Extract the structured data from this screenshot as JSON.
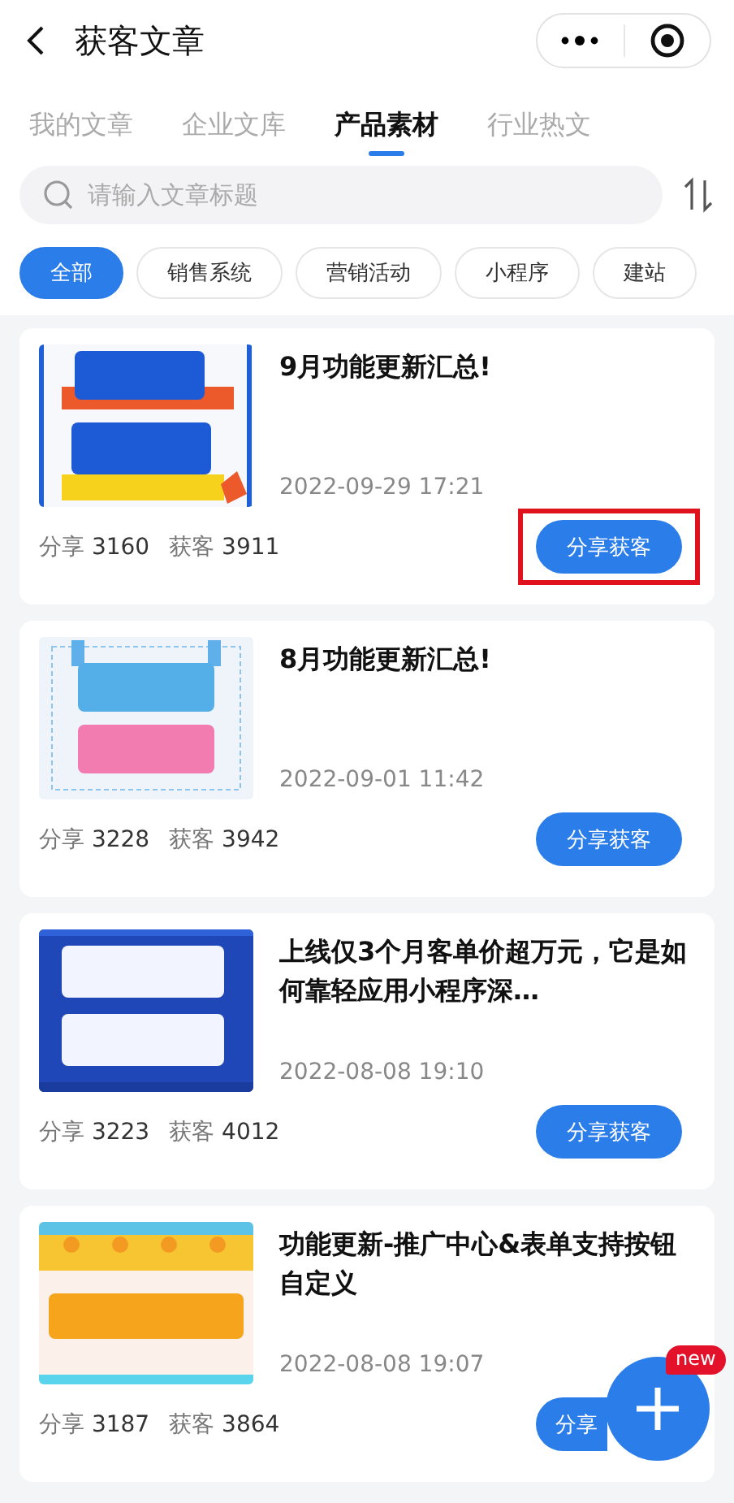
{
  "header": {
    "title": "获客文章"
  },
  "tabs": [
    {
      "label": "我的文章",
      "selected": false
    },
    {
      "label": "企业文库",
      "selected": false
    },
    {
      "label": "产品素材",
      "selected": true
    },
    {
      "label": "行业热文",
      "selected": false
    }
  ],
  "search": {
    "placeholder": "请输入文章标题"
  },
  "filters": [
    {
      "label": "全部",
      "selected": true
    },
    {
      "label": "销售系统",
      "selected": false
    },
    {
      "label": "营销活动",
      "selected": false
    },
    {
      "label": "小程序",
      "selected": false
    },
    {
      "label": "建站",
      "selected": false
    }
  ],
  "articles": [
    {
      "title": "9月功能更新汇总!",
      "date": "2022-09-29 17:21",
      "shares_label": "分享",
      "shares": "3160",
      "leads_label": "获客",
      "leads": "3911",
      "button": "分享获客",
      "highlighted": true
    },
    {
      "title": "8月功能更新汇总!",
      "date": "2022-09-01 11:42",
      "shares_label": "分享",
      "shares": "3228",
      "leads_label": "获客",
      "leads": "3942",
      "button": "分享获客",
      "highlighted": false
    },
    {
      "title": "上线仅3个月客单价超万元，它是如何靠轻应用小程序深…",
      "date": "2022-08-08 19:10",
      "shares_label": "分享",
      "shares": "3223",
      "leads_label": "获客",
      "leads": "4012",
      "button": "分享获客",
      "highlighted": false
    },
    {
      "title": "功能更新-推广中心&表单支持按钮自定义",
      "date": "2022-08-08 19:07",
      "shares_label": "分享",
      "shares": "3187",
      "leads_label": "获客",
      "leads": "3864",
      "button": "分享",
      "highlighted": false
    }
  ],
  "fab": {
    "badge": "new"
  }
}
